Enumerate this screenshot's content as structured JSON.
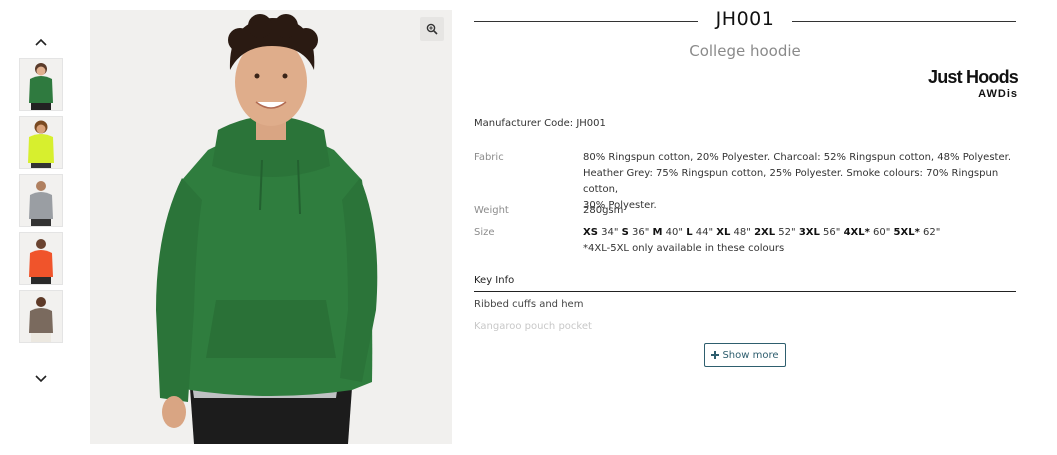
{
  "product": {
    "code": "JH001",
    "name": "College hoodie",
    "brand_name": "Just Hoods",
    "brand_sub": "AWDis",
    "manufacturer_code": "Manufacturer Code: JH001"
  },
  "gallery": {
    "thumbnail_colors": [
      "#2f7a3f",
      "#d7ef2e",
      "#9a9ea3",
      "#f0542b",
      "#7a6a5e"
    ],
    "main_color": "#2f7d3e",
    "prev_icon": "chevron-up-icon",
    "next_icon": "chevron-down-icon",
    "zoom_icon": "zoom-in-icon"
  },
  "specs": {
    "fabric_label": "Fabric",
    "fabric_lines": [
      "80% Ringspun cotton, 20% Polyester. Charcoal: 52% Ringspun cotton, 48% Polyester.",
      "Heather Grey: 75% Ringspun cotton, 25% Polyester. Smoke colours: 70% Ringspun cotton,",
      "30% Polyester."
    ],
    "weight_label": "Weight",
    "weight_value": "280gsm",
    "size_label": "Size",
    "sizes": [
      {
        "size": "XS",
        "chest": "34\""
      },
      {
        "size": "S",
        "chest": "36\""
      },
      {
        "size": "M",
        "chest": "40\""
      },
      {
        "size": "L",
        "chest": "44\""
      },
      {
        "size": "XL",
        "chest": "48\""
      },
      {
        "size": "2XL",
        "chest": "52\""
      },
      {
        "size": "3XL",
        "chest": "56\""
      },
      {
        "size": "4XL*",
        "chest": "60\""
      },
      {
        "size": "5XL*",
        "chest": "62\""
      }
    ],
    "size_note": "*4XL-5XL only available in these colours"
  },
  "key_info": {
    "heading": "Key Info",
    "features": [
      "Ribbed cuffs and hem",
      "Kangaroo pouch pocket"
    ],
    "show_more_label": "Show more",
    "show_more_icon": "plus-icon"
  }
}
